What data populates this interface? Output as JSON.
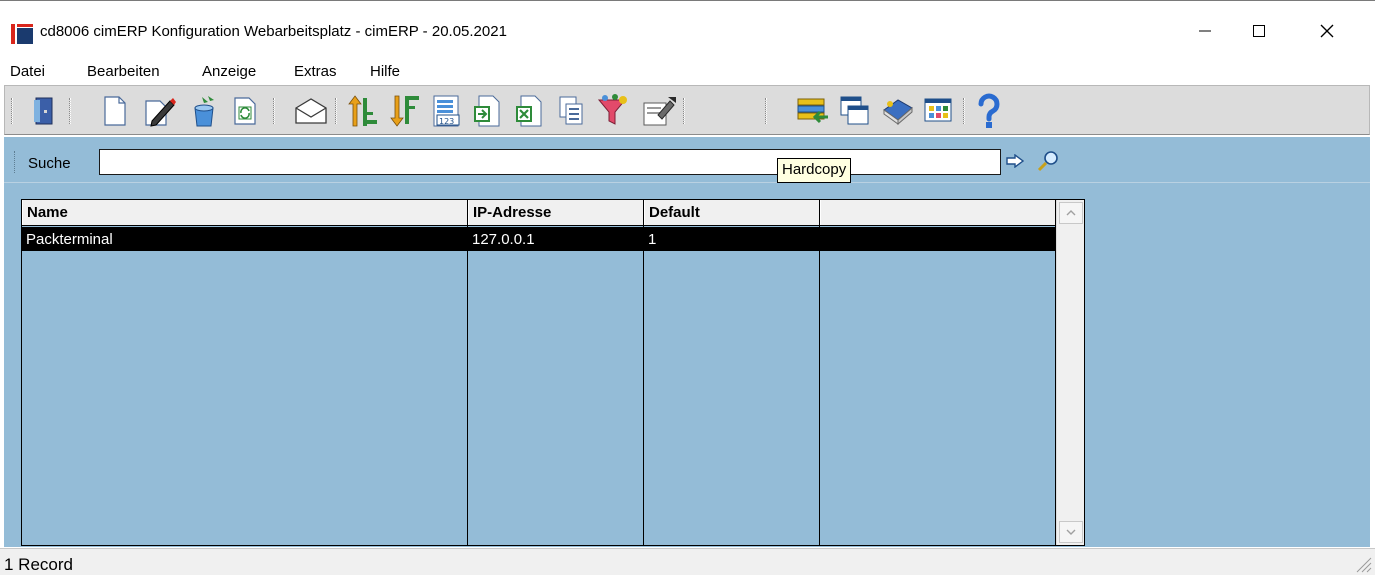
{
  "window": {
    "title": "cd8006 cimERP Konfiguration Webarbeitsplatz - cimERP - 20.05.2021",
    "controls": {
      "minimize": "minimize-icon",
      "maximize": "maximize-icon",
      "close": "close-icon"
    }
  },
  "menu": {
    "items": [
      {
        "label": "Datei"
      },
      {
        "label": "Bearbeiten"
      },
      {
        "label": "Anzeige"
      },
      {
        "label": "Extras"
      },
      {
        "label": "Hilfe"
      }
    ]
  },
  "toolbar": {
    "buttons": [
      "exit-door-icon",
      "new-document-icon",
      "edit-pencil-icon",
      "save-bucket-icon",
      "refresh-icon",
      "mail-envelope-icon",
      "sort-ascending-icon",
      "sort-descending-icon",
      "number-format-icon",
      "export-icon",
      "excel-export-icon",
      "copy-pages-icon",
      "filter-funnel-icon",
      "hardcopy-icon",
      "list-import-icon",
      "windows-icon",
      "book-icon",
      "grid-view-icon",
      "help-question-icon"
    ],
    "tooltip": "Hardcopy"
  },
  "search": {
    "label": "Suche",
    "value": "",
    "placeholder": "",
    "go_icon": "arrow-right-icon",
    "find_icon": "magnifier-icon"
  },
  "grid": {
    "columns": [
      "Name",
      "IP-Adresse",
      "Default",
      ""
    ],
    "rows": [
      {
        "name": "Packterminal",
        "ip": "127.0.0.1",
        "default": "1",
        "extra": ""
      }
    ],
    "selected_row": 0
  },
  "status": {
    "text": "1 Record"
  },
  "colors": {
    "panel_bg": "#94bcd7",
    "toolbar_bg": "#dcdcdc",
    "selected_row_bg": "#000000",
    "tooltip_bg": "#ffffe1"
  }
}
